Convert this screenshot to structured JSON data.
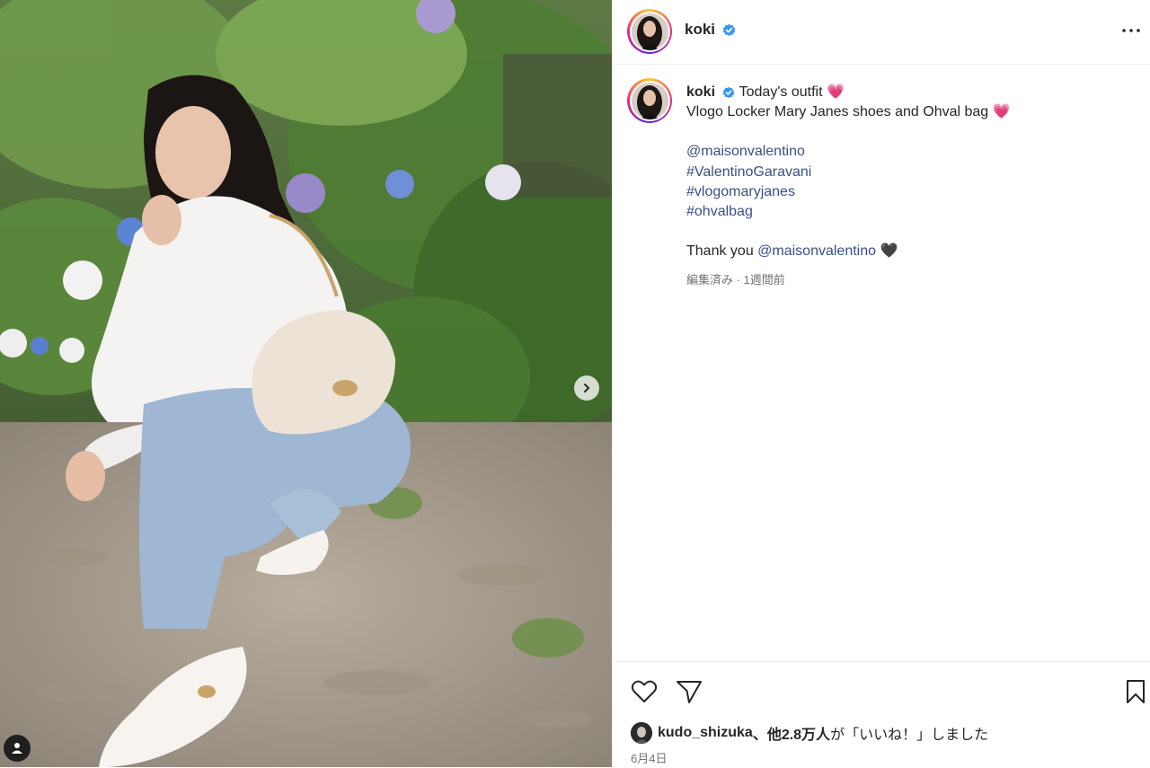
{
  "post": {
    "username": "koki",
    "caption_title": "Today's outfit",
    "caption_line2": "Vlogo Locker Mary Janes shoes and Ohval bag",
    "heart_emoji": "💗",
    "mentions": [
      "@maisonvalentino",
      "#ValentinoGaravani",
      "#vlogomaryjanes",
      "#ohvalbag"
    ],
    "thanks_prefix": "Thank you ",
    "thanks_mention": "@maisonvalentino",
    "thanks_emoji": "🖤",
    "meta": "編集済み · 1週間前",
    "likes_user": "kudo_shizuka",
    "likes_text_bold": "、他2.8万人",
    "likes_text_rest": "が「いいね！」しました",
    "date": "6月4日"
  },
  "colors": {
    "link": "#385185",
    "verified": "#3897f0",
    "text": "#262626",
    "muted": "#737373"
  },
  "icons": {
    "verified": "verified-badge-icon",
    "more": "more-options-icon",
    "like": "heart-icon",
    "share": "send-icon",
    "save": "bookmark-icon",
    "next": "chevron-right-icon",
    "tags": "user-tag-icon"
  }
}
